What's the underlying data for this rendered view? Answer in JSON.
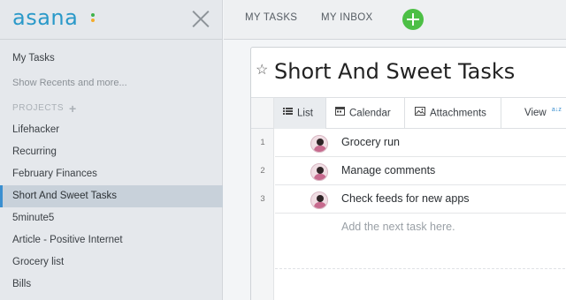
{
  "sidebar": {
    "logo": "asana",
    "logo_dot_colors": [
      "#3fb24b",
      "#f3ac2c",
      "#3fb24b"
    ],
    "my_tasks": "My Tasks",
    "show_recents": "Show Recents and more...",
    "projects_heading": "PROJECTS",
    "projects_add": "+",
    "projects": [
      "Lifehacker",
      "Recurring",
      "February Finances",
      "Short And Sweet Tasks",
      "5minute5",
      "Article - Positive Internet",
      "Grocery list",
      "Bills"
    ],
    "active_project_index": 3
  },
  "topbar": {
    "my_tasks": "MY TASKS",
    "my_inbox": "MY INBOX",
    "add_icon": "plus-circle-icon",
    "add_color": "#4cbf45"
  },
  "project": {
    "title": "Short And Sweet Tasks",
    "star_icon": "star-outline-icon",
    "tabs": [
      {
        "label": "List",
        "icon": "list-icon"
      },
      {
        "label": "Calendar",
        "icon": "calendar-icon"
      },
      {
        "label": "Attachments",
        "icon": "image-icon"
      },
      {
        "label": "View",
        "icon": "sort-icon"
      }
    ],
    "sort_badge": "a↓z",
    "tasks": [
      {
        "num": "1",
        "name": "Grocery run"
      },
      {
        "num": "2",
        "name": "Manage comments"
      },
      {
        "num": "3",
        "name": "Check feeds for new apps"
      }
    ],
    "new_task_placeholder": "Add the next task here."
  },
  "colors": {
    "brand": "#2a99c9",
    "active_border": "#3a8fd0"
  }
}
